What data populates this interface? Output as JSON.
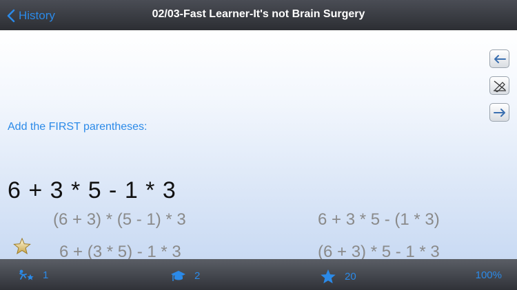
{
  "nav": {
    "back_label": "History",
    "title": "02/03-Fast Learner-It's not Brain Surgery"
  },
  "side_buttons": {
    "prev": "prev-arrow-icon",
    "clear": "no-pencil-icon",
    "next": "next-arrow-icon"
  },
  "question": {
    "prompt": "Add the FIRST parentheses:",
    "expression": "6 + 3 * 5 - 1 * 3"
  },
  "options": [
    "(6 + 3) * (5 - 1) * 3",
    "6 + 3 * 5 - (1 * 3)",
    "6 + (3 * 5) - 1 * 3",
    "(6 + 3) * 5 - 1 * 3"
  ],
  "status": {
    "streak_count": "1",
    "level_count": "2",
    "stars_count": "20",
    "percent": "100%"
  },
  "colors": {
    "accent": "#2b8ae8",
    "option_text": "#8a8a8a",
    "bar_dark": "#303238"
  }
}
